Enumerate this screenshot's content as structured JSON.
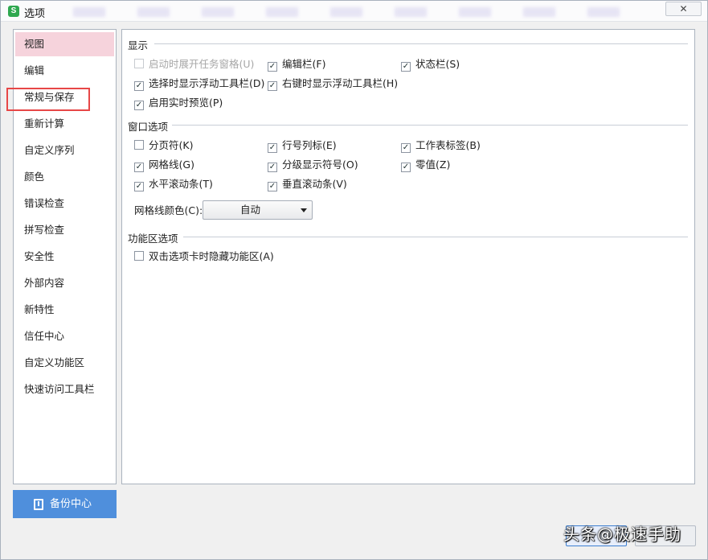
{
  "window": {
    "title": "选项",
    "app_icon_letter": "S",
    "close_glyph": "✕"
  },
  "sidebar": {
    "items": [
      {
        "label": "视图",
        "active": true
      },
      {
        "label": "编辑"
      },
      {
        "label": "常规与保存"
      },
      {
        "label": "重新计算"
      },
      {
        "label": "自定义序列"
      },
      {
        "label": "颜色"
      },
      {
        "label": "错误检查"
      },
      {
        "label": "拼写检查"
      },
      {
        "label": "安全性"
      },
      {
        "label": "外部内容"
      },
      {
        "label": "新特性"
      },
      {
        "label": "信任中心"
      },
      {
        "label": "自定义功能区"
      },
      {
        "label": "快速访问工具栏"
      }
    ],
    "backup_label": "备份中心"
  },
  "display": {
    "title": "显示",
    "options": [
      {
        "label": "启动时展开任务窗格(U)",
        "checked": false,
        "disabled": true
      },
      {
        "label": "编辑栏(F)",
        "checked": true
      },
      {
        "label": "状态栏(S)",
        "checked": true
      },
      {
        "label": "选择时显示浮动工具栏(D)",
        "checked": true
      },
      {
        "label": "右键时显示浮动工具栏(H)",
        "checked": true
      },
      {
        "label": "启用实时预览(P)",
        "checked": true
      }
    ]
  },
  "window_options": {
    "title": "窗口选项",
    "options": [
      {
        "label": "分页符(K)",
        "checked": false
      },
      {
        "label": "行号列标(E)",
        "checked": true
      },
      {
        "label": "工作表标签(B)",
        "checked": true
      },
      {
        "label": "网格线(G)",
        "checked": true
      },
      {
        "label": "分级显示符号(O)",
        "checked": true
      },
      {
        "label": "零值(Z)",
        "checked": true
      },
      {
        "label": "水平滚动条(T)",
        "checked": true
      },
      {
        "label": "垂直滚动条(V)",
        "checked": true
      }
    ],
    "grid_color_label": "网格线颜色(C):",
    "grid_color_value": "自动"
  },
  "ribbon_options": {
    "title": "功能区选项",
    "options": [
      {
        "label": "双击选项卡时隐藏功能区(A)",
        "checked": false
      }
    ]
  },
  "watermark": "头条@极速手助",
  "check_glyph": "✓"
}
